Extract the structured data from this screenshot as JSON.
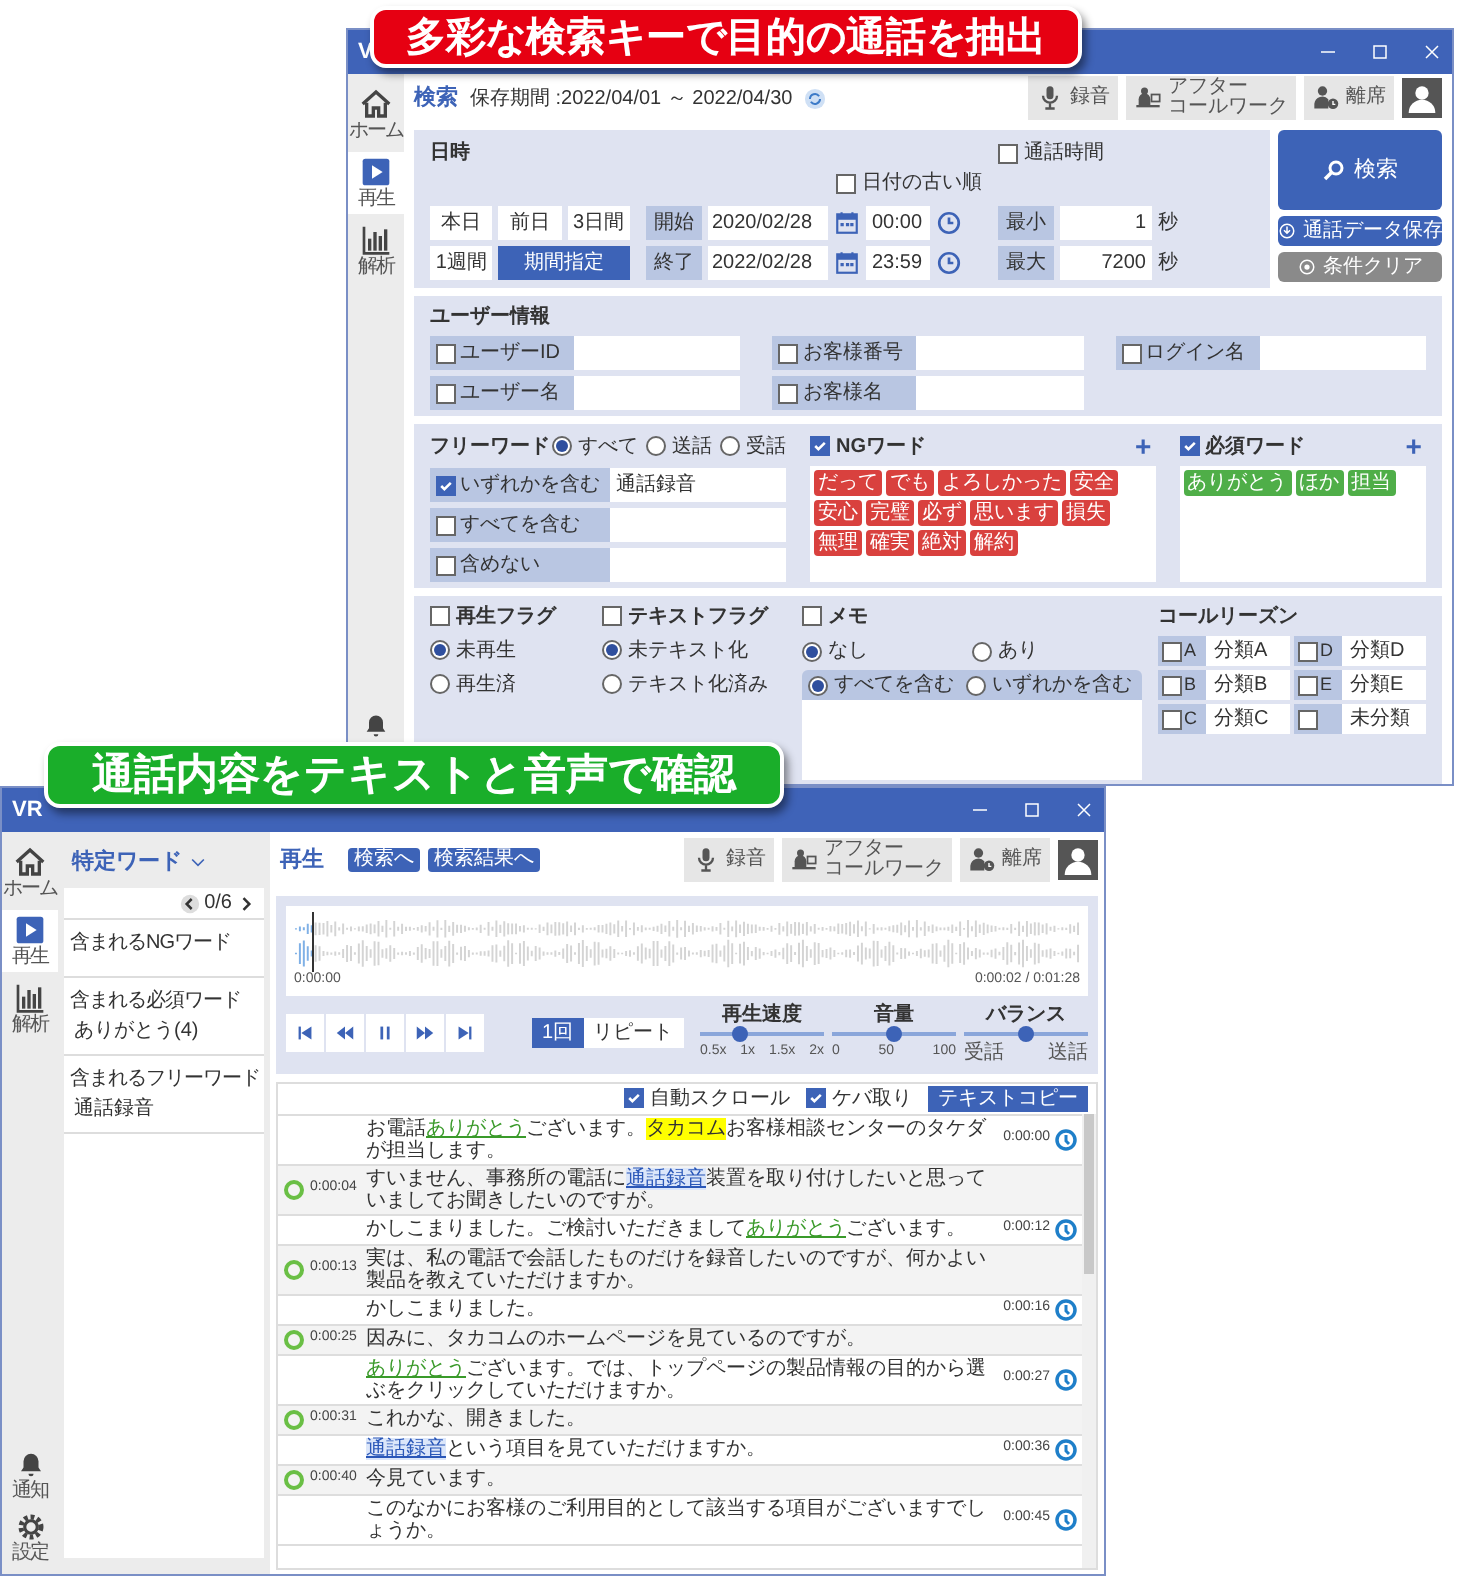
{
  "banners": [
    {
      "text": "多彩な検索キーで目的の通話を抽出",
      "color": "#e60012"
    },
    {
      "text": "通話内容をテキストと音声で確認",
      "color": "#1aae2a"
    }
  ],
  "search_window": {
    "title": "V",
    "sidebar": [
      {
        "kind": "home",
        "label": "ホーム",
        "selected": false
      },
      {
        "kind": "play",
        "label": "再生",
        "selected": true
      },
      {
        "kind": "chart",
        "label": "解析",
        "selected": false
      }
    ],
    "sidebar_bottom": [
      {
        "kind": "bell"
      }
    ],
    "heading": "検索",
    "retention": "保存期間 :2022/04/01 ～ 2022/04/30",
    "toolbar": [
      {
        "kind": "mic",
        "lines": [
          "録音"
        ]
      },
      {
        "kind": "desk",
        "lines": [
          "アフター",
          "コールワーク"
        ]
      },
      {
        "kind": "away",
        "lines": [
          "離席"
        ]
      },
      {
        "kind": "user"
      }
    ],
    "date": {
      "title": "日時",
      "call_time": {
        "label": "通話時間",
        "checked": false
      },
      "oldest_first": {
        "label": "日付の古い順",
        "checked": false
      },
      "ranges": [
        {
          "label": "本日",
          "selected": false
        },
        {
          "label": "前日",
          "selected": false
        },
        {
          "label": "3日間",
          "selected": false
        },
        {
          "label": "1週間",
          "selected": false
        },
        {
          "label": "期間指定",
          "selected": true
        }
      ],
      "period": [
        {
          "label": "開始",
          "date": "2020/02/28",
          "time": "00:00"
        },
        {
          "label": "終了",
          "date": "2022/02/28",
          "time": "23:59"
        }
      ],
      "duration": [
        {
          "label": "最小",
          "value": "1",
          "unit": "秒"
        },
        {
          "label": "最大",
          "value": "7200",
          "unit": "秒"
        }
      ]
    },
    "actions": [
      {
        "kind": "search",
        "label": "検索"
      },
      {
        "kind": "save",
        "label": "通話データ保存"
      },
      {
        "kind": "clear",
        "label": "条件クリア"
      }
    ],
    "user_info": {
      "title": "ユーザー情報",
      "columns": [
        [
          {
            "label": "ユーザーID",
            "checked": false
          },
          {
            "label": "ユーザー名",
            "checked": false
          }
        ],
        [
          {
            "label": "お客様番号",
            "checked": false
          },
          {
            "label": "お客様名",
            "checked": false
          }
        ],
        [
          {
            "label": "ログイン名",
            "checked": false
          }
        ]
      ]
    },
    "free_word": {
      "title": "フリーワード",
      "scope": [
        {
          "label": "すべて",
          "selected": true
        },
        {
          "label": "送話",
          "selected": false
        },
        {
          "label": "受話",
          "selected": false
        }
      ],
      "rows": [
        {
          "label": "いずれかを含む",
          "checked": true,
          "value": "通話録音"
        },
        {
          "label": "すべてを含む",
          "checked": false
        },
        {
          "label": "含めない",
          "checked": false
        }
      ]
    },
    "word_lists": [
      {
        "kind": "ng",
        "label": "NGワード",
        "checked": true,
        "add": "+",
        "tags": [
          "だって",
          "でも",
          "よろしかった",
          "安全",
          "安心",
          "完璧",
          "必ず",
          "思います",
          "損失",
          "無理",
          "確実",
          "絶対",
          "解約"
        ]
      },
      {
        "kind": "required",
        "label": "必須ワード",
        "checked": true,
        "add": "+",
        "tags": [
          "ありがとう",
          "ほか",
          "担当"
        ]
      }
    ],
    "flags": [
      {
        "label": "再生フラグ",
        "checked": false,
        "options": [
          {
            "label": "未再生",
            "selected": true
          },
          {
            "label": "再生済",
            "selected": false
          }
        ]
      },
      {
        "label": "テキストフラグ",
        "checked": false,
        "options": [
          {
            "label": "未テキスト化",
            "selected": true
          },
          {
            "label": "テキスト化済み",
            "selected": false
          }
        ]
      }
    ],
    "memo": {
      "label": "メモ",
      "checked": false,
      "options": [
        {
          "label": "なし",
          "selected": true
        },
        {
          "label": "あり",
          "selected": false
        }
      ],
      "match": [
        {
          "label": "すべてを含む",
          "selected": true
        },
        {
          "label": "いずれかを含む",
          "selected": false
        }
      ]
    },
    "call_reason": {
      "title": "コールリーズン",
      "items": [
        {
          "key": "A",
          "label": "分類A",
          "checked": false
        },
        {
          "key": "D",
          "label": "分類D",
          "checked": false
        },
        {
          "key": "B",
          "label": "分類B",
          "checked": false
        },
        {
          "key": "E",
          "label": "分類E",
          "checked": false
        },
        {
          "key": "C",
          "label": "分類C",
          "checked": false
        },
        {
          "label": "未分類",
          "checked": false
        }
      ]
    }
  },
  "playback_window": {
    "title": "VR",
    "sidebar": [
      {
        "kind": "home",
        "label": "ホーム",
        "selected": false
      },
      {
        "kind": "play",
        "label": "再生",
        "selected": true
      },
      {
        "kind": "chart",
        "label": "解析",
        "selected": false
      }
    ],
    "sidebar_bottom": [
      {
        "kind": "bell",
        "label": "通知"
      },
      {
        "kind": "gear",
        "label": "設定"
      }
    ],
    "word_panel": {
      "title": "特定ワード",
      "counter": "0/6",
      "items": [
        {
          "title": "含まれるNGワード"
        },
        {
          "title": "含まれる必須ワード",
          "detail": "ありがとう(4)"
        },
        {
          "title": "含まれるフリーワード",
          "detail": "通話録音"
        }
      ]
    },
    "heading": "再生",
    "links": [
      "検索へ",
      "検索結果へ"
    ],
    "toolbar": [
      {
        "kind": "mic",
        "lines": [
          "録音"
        ]
      },
      {
        "kind": "desk",
        "lines": [
          "アフター",
          "コールワーク"
        ]
      },
      {
        "kind": "away",
        "lines": [
          "離席"
        ]
      },
      {
        "kind": "user"
      }
    ],
    "player": {
      "start": "0:00:00",
      "position": "0:00:02 / 0:01:28",
      "level": 0.023,
      "controls": [
        {
          "kind": "first"
        },
        {
          "kind": "rewind"
        },
        {
          "kind": "pause"
        },
        {
          "kind": "forward"
        },
        {
          "kind": "last"
        }
      ],
      "repeat": [
        {
          "label": "1回",
          "selected": true
        },
        {
          "label": "リピート",
          "selected": false
        }
      ],
      "sliders": [
        {
          "label": "再生速度",
          "level": 0.33,
          "ticks": [
            "0.5x",
            "1x",
            "1.5x",
            "2x"
          ]
        },
        {
          "label": "音量",
          "level": 0.5,
          "ticks": [
            "0",
            "50",
            "100"
          ]
        },
        {
          "label": "バランス",
          "level": 0.5,
          "ticks": [
            "受話",
            "送話"
          ]
        }
      ]
    },
    "transcript": {
      "options": [
        {
          "label": "自動スクロール",
          "checked": true
        },
        {
          "label": "ケバ取り",
          "checked": true
        }
      ],
      "copy": "テキストコピー",
      "rows": [
        {
          "kind": "operator",
          "time": "0:00:00",
          "segments": [
            {
              "kind": "text",
              "text": "お電話"
            },
            {
              "kind": "must",
              "text": "ありがとう"
            },
            {
              "kind": "text",
              "text": "ございます。"
            },
            {
              "kind": "highlight",
              "text": "タカコム"
            },
            {
              "kind": "text",
              "text": "お客様相談センターのタケダが担当します。"
            }
          ]
        },
        {
          "kind": "customer",
          "time": "0:00:04",
          "segments": [
            {
              "kind": "text",
              "text": "すいません、事務所の電話に"
            },
            {
              "kind": "free",
              "text": "通話録音"
            },
            {
              "kind": "text",
              "text": "装置を取り付けしたいと思っていましてお聞きしたいのですが。"
            }
          ]
        },
        {
          "kind": "operator",
          "time": "0:00:12",
          "segments": [
            {
              "kind": "text",
              "text": "かしこまりました。ご検討いただきまして"
            },
            {
              "kind": "must",
              "text": "ありがとう"
            },
            {
              "kind": "text",
              "text": "ございます。"
            }
          ]
        },
        {
          "kind": "customer",
          "time": "0:00:13",
          "segments": [
            {
              "kind": "text",
              "text": "実は、私の電話で会話したものだけを録音したいのですが、何かよい製品を教えていただけますか。"
            }
          ]
        },
        {
          "kind": "operator",
          "time": "0:00:16",
          "segments": [
            {
              "kind": "text",
              "text": "かしこまりました。"
            }
          ]
        },
        {
          "kind": "customer",
          "time": "0:00:25",
          "segments": [
            {
              "kind": "text",
              "text": "因みに、タカコムのホームページを見ているのですが。"
            }
          ]
        },
        {
          "kind": "operator",
          "time": "0:00:27",
          "segments": [
            {
              "kind": "must",
              "text": "ありがとう"
            },
            {
              "kind": "text",
              "text": "ございます。では、トップページの製品情報の目的から選ぶをクリックしていただけますか。"
            }
          ]
        },
        {
          "kind": "customer",
          "time": "0:00:31",
          "segments": [
            {
              "kind": "text",
              "text": "これかな、開きました。"
            }
          ]
        },
        {
          "kind": "operator",
          "time": "0:00:36",
          "segments": [
            {
              "kind": "free",
              "text": "通話録音"
            },
            {
              "kind": "text",
              "text": "という項目を見ていただけますか。"
            }
          ]
        },
        {
          "kind": "customer",
          "time": "0:00:40",
          "segments": [
            {
              "kind": "text",
              "text": "今見ています。"
            }
          ]
        },
        {
          "kind": "operator",
          "time": "0:00:45",
          "segments": [
            {
              "kind": "text",
              "text": "このなかにお客様のご利用目的として該当する項目がございますでしょうか。"
            }
          ]
        }
      ]
    }
  }
}
